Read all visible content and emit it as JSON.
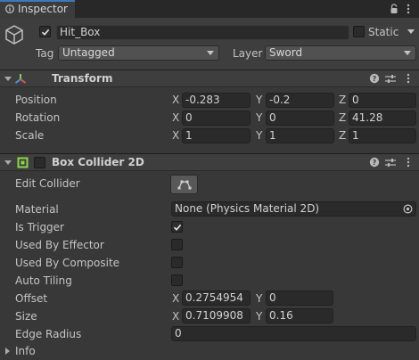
{
  "tab": {
    "label": "Inspector",
    "lock_icon": "lock-icon",
    "menu_icon": "kebab-menu-icon"
  },
  "object": {
    "name": "Hit_Box",
    "active": true,
    "static_label": "Static",
    "tag_label": "Tag",
    "tag_value": "Untagged",
    "layer_label": "Layer",
    "layer_value": "Sword"
  },
  "transform": {
    "title": "Transform",
    "rows": [
      {
        "label": "Position",
        "x": "-0.283",
        "y": "-0.2",
        "z": "0"
      },
      {
        "label": "Rotation",
        "x": "0",
        "y": "0",
        "z": "41.28"
      },
      {
        "label": "Scale",
        "x": "1",
        "y": "1",
        "z": "1"
      }
    ]
  },
  "axes": {
    "x": "X",
    "y": "Y",
    "z": "Z"
  },
  "collider": {
    "title": "Box Collider 2D",
    "enabled": false,
    "edit_collider": "Edit Collider",
    "material_label": "Material",
    "material_value": "None (Physics Material 2D)",
    "is_trigger_label": "Is Trigger",
    "is_trigger": true,
    "used_by_effector_label": "Used By Effector",
    "used_by_composite_label": "Used By Composite",
    "auto_tiling_label": "Auto Tiling",
    "offset_label": "Offset",
    "offset_x": "0.2754954",
    "offset_y": "0",
    "size_label": "Size",
    "size_x": "0.7109908",
    "size_y": "0.16",
    "edge_radius_label": "Edge Radius",
    "edge_radius_value": "0",
    "info_label": "Info"
  },
  "colors": {
    "accent": "#3a79bb",
    "collider_green": "#8ed64a",
    "bg": "#383838"
  }
}
